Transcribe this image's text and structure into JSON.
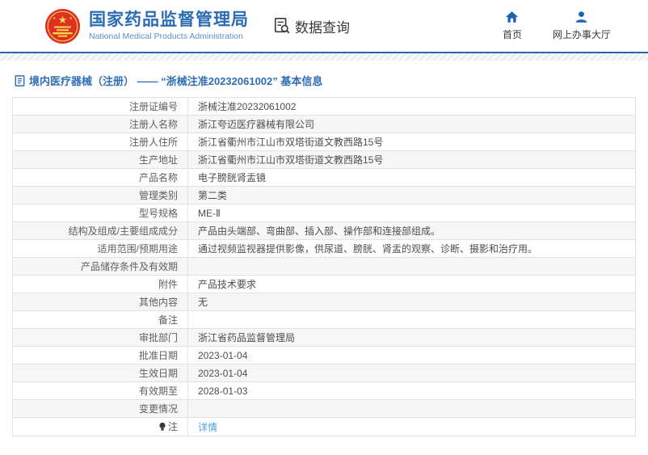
{
  "header": {
    "org_name_zh": "国家药品监督管理局",
    "org_name_en": "National Medical Products Administration",
    "data_query_label": "数据查询",
    "nav": [
      {
        "label": "首页",
        "icon": "home-icon"
      },
      {
        "label": "网上办事大厅",
        "icon": "person-icon"
      }
    ]
  },
  "page_title": "境内医疗器械（注册） —— “浙械注准20232061002” 基本信息",
  "table": {
    "rows": [
      {
        "label": "注册证编号",
        "value": "浙械注准20232061002"
      },
      {
        "label": "注册人名称",
        "value": "浙江夸迈医疗器械有限公司"
      },
      {
        "label": "注册人住所",
        "value": "浙江省衢州市江山市双塔街道文教西路15号"
      },
      {
        "label": "生产地址",
        "value": "浙江省衢州市江山市双塔街道文教西路15号"
      },
      {
        "label": "产品名称",
        "value": "电子膀胱肾盂镜"
      },
      {
        "label": "管理类别",
        "value": "第二类"
      },
      {
        "label": "型号规格",
        "value": "ME-Ⅱ"
      },
      {
        "label": "结构及组成/主要组成成分",
        "value": "产品由头端部、弯曲部、插入部、操作部和连接部组成。"
      },
      {
        "label": "适用范围/预期用途",
        "value": "通过视频监视器提供影像，供尿道、膀胱、肾盂的观察、诊断、摄影和治疗用。"
      },
      {
        "label": "产品储存条件及有效期",
        "value": ""
      },
      {
        "label": "附件",
        "value": "产品技术要求"
      },
      {
        "label": "其他内容",
        "value": "无"
      },
      {
        "label": "备注",
        "value": ""
      },
      {
        "label": "审批部门",
        "value": "浙江省药品监督管理局"
      },
      {
        "label": "批准日期",
        "value": "2023-01-04"
      },
      {
        "label": "生效日期",
        "value": "2023-01-04"
      },
      {
        "label": "有效期至",
        "value": "2028-01-03"
      },
      {
        "label": "变更情况",
        "value": ""
      },
      {
        "label": "注",
        "value": "详情",
        "link": true,
        "icon": "note-bulb-icon"
      }
    ]
  },
  "colors": {
    "brand_blue": "#2b6cb3",
    "header_line_blue": "#2566ad",
    "link_blue": "#4a9ede",
    "emblem_red": "#de3023",
    "emblem_gold": "#f9d64a",
    "row_alt_gray": "#f6f6f6"
  }
}
